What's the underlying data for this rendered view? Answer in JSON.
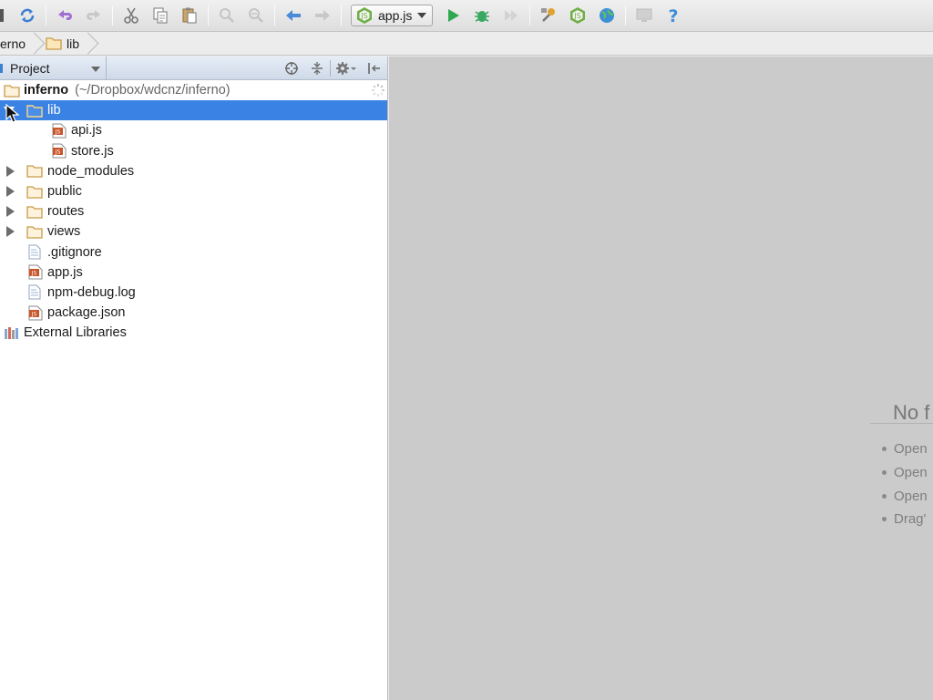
{
  "toolbar": {
    "run_config_label": "app.js"
  },
  "breadcrumb": {
    "items": [
      "erno",
      "lib"
    ]
  },
  "project_panel": {
    "view_label": "Project",
    "tree": [
      {
        "label": "inferno",
        "path": "(~/Dropbox/wdcnz/inferno)",
        "type": "project-root"
      },
      {
        "label": "lib",
        "type": "folder",
        "expanded": true,
        "selected": true
      },
      {
        "label": "api.js",
        "type": "js-file"
      },
      {
        "label": "store.js",
        "type": "js-file"
      },
      {
        "label": "node_modules",
        "type": "folder"
      },
      {
        "label": "public",
        "type": "folder"
      },
      {
        "label": "routes",
        "type": "folder"
      },
      {
        "label": "views",
        "type": "folder"
      },
      {
        "label": ".gitignore",
        "type": "text-file"
      },
      {
        "label": "app.js",
        "type": "js-file"
      },
      {
        "label": "npm-debug.log",
        "type": "text-file"
      },
      {
        "label": "package.json",
        "type": "json-file"
      },
      {
        "label": "External Libraries",
        "type": "libraries"
      }
    ]
  },
  "editor": {
    "empty_title": "No f",
    "hints": [
      "Open",
      "Open",
      "Open",
      "Drag'"
    ]
  },
  "colors": {
    "selection": "#3a82e4",
    "editor_bg": "#cbcbcb",
    "folder": "#c99a4a",
    "run_green": "#2fa84f"
  }
}
